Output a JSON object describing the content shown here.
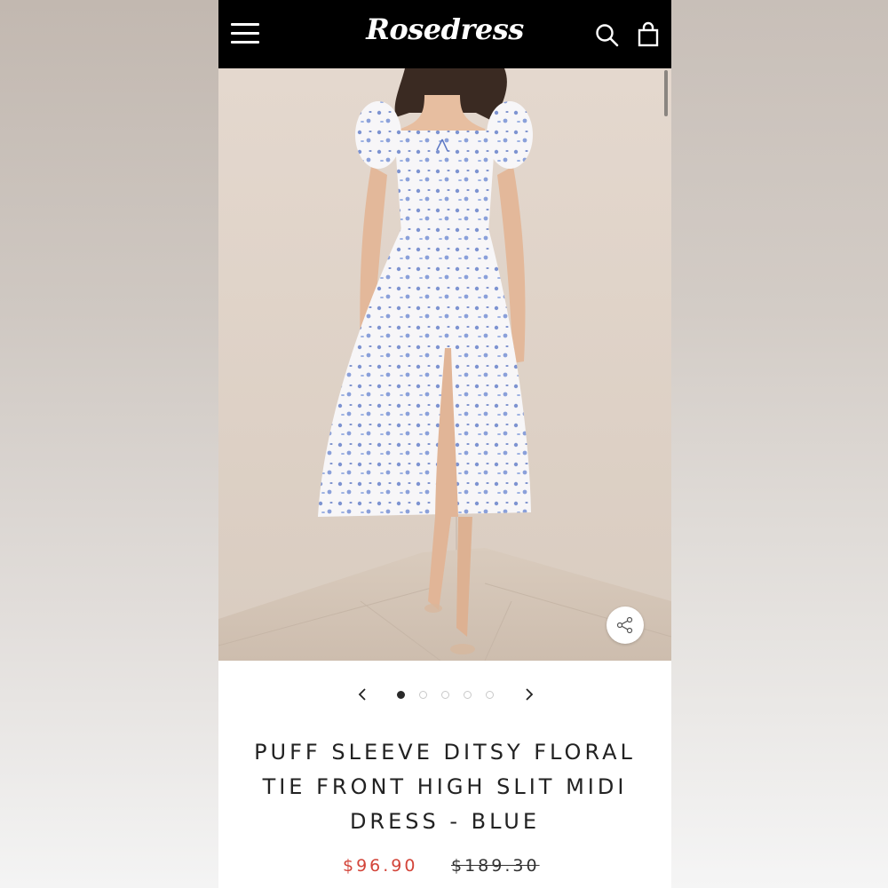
{
  "header": {
    "brand": "Rosedress",
    "menu_icon": "hamburger-menu-icon",
    "search_icon": "search-icon",
    "cart_icon": "shopping-bag-icon"
  },
  "product": {
    "image_description": "Model wearing white puff sleeve midi dress with blue floral print and high slit",
    "title": "PUFF SLEEVE DITSY FLORAL TIE FRONT HIGH SLIT MIDI DRESS - BLUE",
    "sale_price": "$96.90",
    "original_price": "$189.30"
  },
  "carousel": {
    "slide_count": 5,
    "active_index": 0
  },
  "colors": {
    "header_bg": "#000000",
    "sale_price": "#d3453a",
    "dot_active": "#2a2a2a"
  }
}
